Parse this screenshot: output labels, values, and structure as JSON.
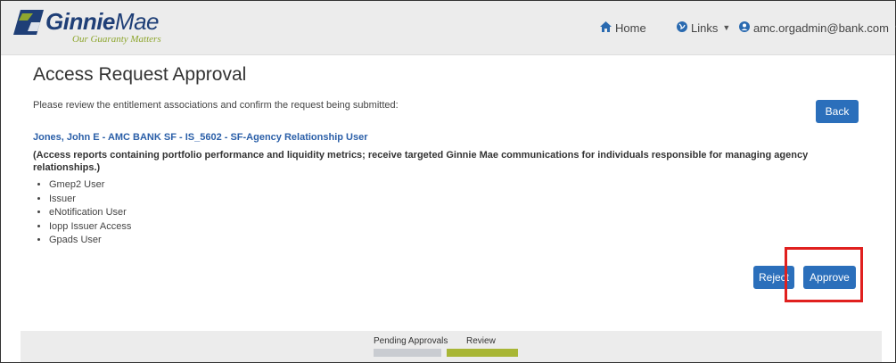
{
  "header": {
    "logo_bold": "Ginnie",
    "logo_light": "Mae",
    "logo_tagline": "Our Guaranty Matters",
    "nav": {
      "home_label": "Home",
      "links_label": "Links",
      "user_label": "amc.orgadmin@bank.com"
    }
  },
  "page": {
    "title": "Access Request Approval",
    "intro": "Please review the entitlement associations and confirm the request being submitted:",
    "back_label": "Back",
    "entitlement_title": "Jones, John E - AMC BANK SF - IS_5602 - SF-Agency Relationship User",
    "entitlement_description": "(Access reports containing portfolio performance and liquidity metrics; receive targeted Ginnie Mae communications for individuals responsible for managing agency relationships.)",
    "roles": [
      "Gmep2 User",
      "Issuer",
      "eNotification User",
      "Iopp Issuer Access",
      "Gpads User"
    ],
    "reject_label": "Reject",
    "approve_label": "Approve"
  },
  "footer": {
    "steps": [
      {
        "label": "Pending Approvals",
        "color": "#c9ccd1"
      },
      {
        "label": "Review",
        "color": "#a8b635"
      }
    ]
  },
  "colors": {
    "primary_button": "#2b6fbb",
    "link": "#2b5fa8",
    "highlight": "#e0201f",
    "brand_navy": "#1f3f77",
    "brand_green": "#8ea62e"
  }
}
